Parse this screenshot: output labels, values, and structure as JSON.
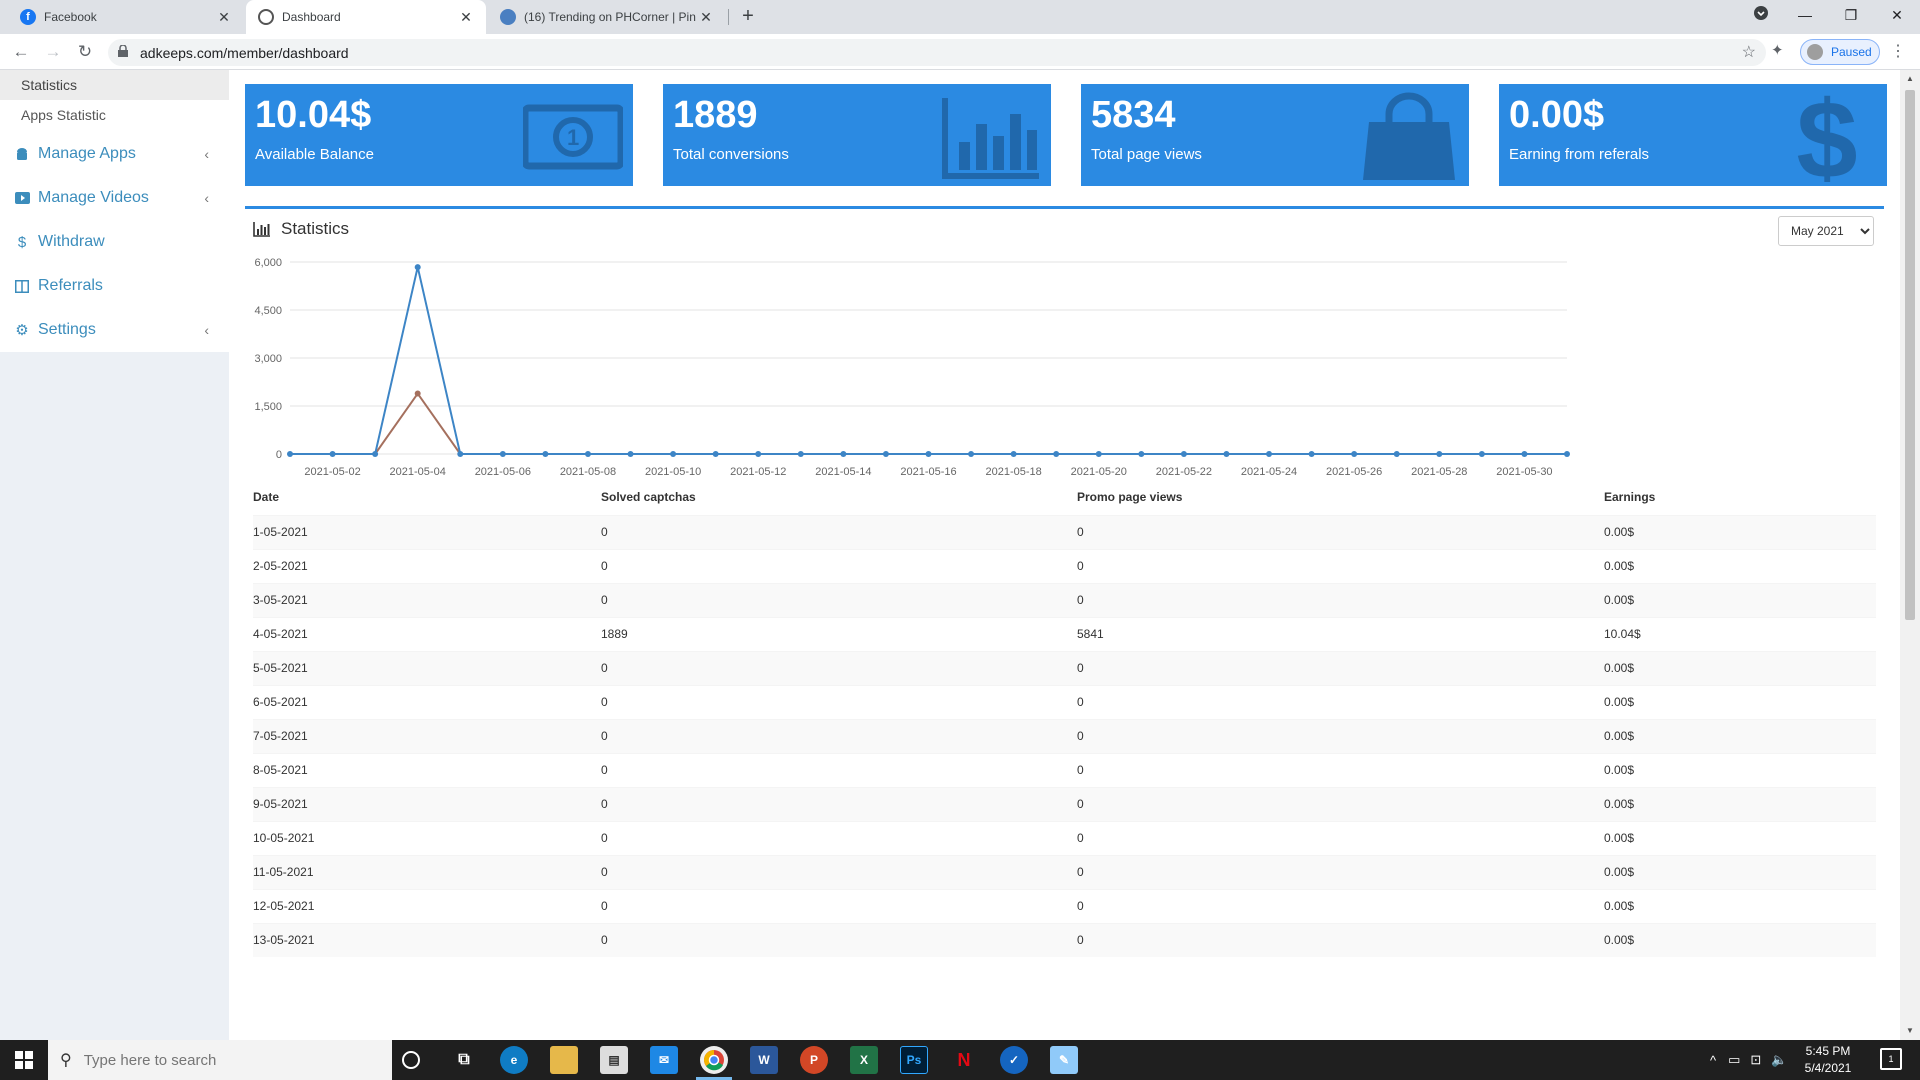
{
  "browser": {
    "tabs": [
      {
        "title": "Facebook",
        "icon": "facebook-icon",
        "color": "#1877f2"
      },
      {
        "title": "Dashboard",
        "icon": "chrome-page-icon",
        "active": true
      },
      {
        "title": "(16) Trending on PHCorner | Pin",
        "icon": "phcorner-icon",
        "color": "#4a7fc1"
      }
    ],
    "url": "adkeeps.com/member/dashboard",
    "profile_label": "Paused"
  },
  "sidebar": {
    "sub_items": [
      "Statistics",
      "Apps Statistic"
    ],
    "items": [
      {
        "label": "Manage Apps",
        "icon": "android-icon",
        "has_chevron": true
      },
      {
        "label": "Manage Videos",
        "icon": "video-icon",
        "has_chevron": true
      },
      {
        "label": "Withdraw",
        "icon": "dollar-icon",
        "has_chevron": false
      },
      {
        "label": "Referrals",
        "icon": "columns-icon",
        "has_chevron": false
      },
      {
        "label": "Settings",
        "icon": "gears-icon",
        "has_chevron": true
      }
    ]
  },
  "cards": [
    {
      "value": "10.04$",
      "label": "Available Balance",
      "icon": "money-bill-icon"
    },
    {
      "value": "1889",
      "label": "Total conversions",
      "icon": "bar-chart-icon"
    },
    {
      "value": "5834",
      "label": "Total page views",
      "icon": "shopping-bag-icon"
    },
    {
      "value": "0.00$",
      "label": "Earning from referals",
      "icon": "dollar-icon"
    }
  ],
  "statistics": {
    "title": "Statistics",
    "month": "May 2021",
    "table": {
      "headers": [
        "Date",
        "Solved captchas",
        "Promo page views",
        "Earnings"
      ],
      "rows": [
        [
          "1-05-2021",
          "0",
          "0",
          "0.00$"
        ],
        [
          "2-05-2021",
          "0",
          "0",
          "0.00$"
        ],
        [
          "3-05-2021",
          "0",
          "0",
          "0.00$"
        ],
        [
          "4-05-2021",
          "1889",
          "5841",
          "10.04$"
        ],
        [
          "5-05-2021",
          "0",
          "0",
          "0.00$"
        ],
        [
          "6-05-2021",
          "0",
          "0",
          "0.00$"
        ],
        [
          "7-05-2021",
          "0",
          "0",
          "0.00$"
        ],
        [
          "8-05-2021",
          "0",
          "0",
          "0.00$"
        ],
        [
          "9-05-2021",
          "0",
          "0",
          "0.00$"
        ],
        [
          "10-05-2021",
          "0",
          "0",
          "0.00$"
        ],
        [
          "11-05-2021",
          "0",
          "0",
          "0.00$"
        ],
        [
          "12-05-2021",
          "0",
          "0",
          "0.00$"
        ],
        [
          "13-05-2021",
          "0",
          "0",
          "0.00$"
        ]
      ]
    }
  },
  "chart_data": {
    "type": "line",
    "x": [
      "2021-05-01",
      "2021-05-02",
      "2021-05-03",
      "2021-05-04",
      "2021-05-05",
      "2021-05-06",
      "2021-05-07",
      "2021-05-08",
      "2021-05-09",
      "2021-05-10",
      "2021-05-11",
      "2021-05-12",
      "2021-05-13",
      "2021-05-14",
      "2021-05-15",
      "2021-05-16",
      "2021-05-17",
      "2021-05-18",
      "2021-05-19",
      "2021-05-20",
      "2021-05-21",
      "2021-05-22",
      "2021-05-23",
      "2021-05-24",
      "2021-05-25",
      "2021-05-26",
      "2021-05-27",
      "2021-05-28",
      "2021-05-29",
      "2021-05-30",
      "2021-05-31"
    ],
    "x_tick_labels": [
      "2021-05-02",
      "2021-05-04",
      "2021-05-06",
      "2021-05-08",
      "2021-05-10",
      "2021-05-12",
      "2021-05-14",
      "2021-05-16",
      "2021-05-18",
      "2021-05-20",
      "2021-05-22",
      "2021-05-24",
      "2021-05-26",
      "2021-05-28",
      "2021-05-30"
    ],
    "series": [
      {
        "color": "#3d85c6",
        "values": [
          0,
          0,
          0,
          5841,
          0,
          0,
          0,
          0,
          0,
          0,
          0,
          0,
          0,
          0,
          0,
          0,
          0,
          0,
          0,
          0,
          0,
          0,
          0,
          0,
          0,
          0,
          0,
          0,
          0,
          0,
          0
        ]
      },
      {
        "color": "#a5705e",
        "values": [
          0,
          0,
          0,
          1889,
          0,
          0,
          0,
          0,
          0,
          0,
          0,
          0,
          0,
          0,
          0,
          0,
          0,
          0,
          0,
          0,
          0,
          0,
          0,
          0,
          0,
          0,
          0,
          0,
          0,
          0,
          0
        ]
      }
    ],
    "ylim": [
      0,
      6000
    ],
    "y_ticks": [
      "0",
      "1,500",
      "3,000",
      "4,500",
      "6,000"
    ],
    "grid": true
  },
  "taskbar": {
    "search_placeholder": "Type here to search",
    "time": "5:45 PM",
    "date": "5/4/2021",
    "notification_count": "1"
  }
}
